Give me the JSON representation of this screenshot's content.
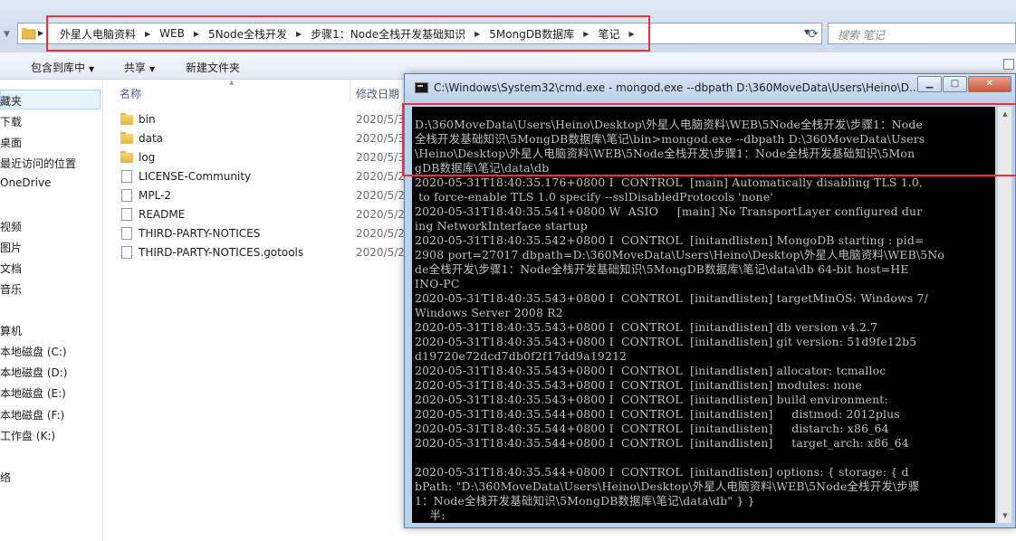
{
  "explorer": {
    "breadcrumbs": [
      "外星人电脑资料",
      "WEB",
      "5Node全栈开发",
      "步骤1：Node全栈开发基础知识",
      "5MongDB数据库",
      "笔记"
    ],
    "search_placeholder": "搜索 笔记",
    "toolbar": {
      "include_library": "包含到库中",
      "share": "共享",
      "new_folder": "新建文件夹"
    },
    "nav": {
      "items": [
        "藏夹",
        "下载",
        "桌面",
        "最近访问的位置",
        "OneDrive",
        "",
        "视频",
        "图片",
        "文档",
        "音乐",
        "",
        "算机",
        "本地磁盘 (C:)",
        "本地磁盘 (D:)",
        "本地磁盘 (E:)",
        "本地磁盘 (F:)",
        "工作盘 (K:)",
        "",
        "络"
      ]
    },
    "columns": {
      "name": "名称",
      "modified": "修改日期"
    },
    "files": [
      {
        "name": "bin",
        "type": "folder",
        "date": "2020/5/3"
      },
      {
        "name": "data",
        "type": "folder",
        "date": "2020/5/3"
      },
      {
        "name": "log",
        "type": "folder",
        "date": "2020/5/3"
      },
      {
        "name": "LICENSE-Community",
        "type": "file",
        "date": "2020/5/2"
      },
      {
        "name": "MPL-2",
        "type": "file",
        "date": "2020/5/2"
      },
      {
        "name": "README",
        "type": "file",
        "date": "2020/5/2"
      },
      {
        "name": "THIRD-PARTY-NOTICES",
        "type": "file",
        "date": "2020/5/2"
      },
      {
        "name": "THIRD-PARTY-NOTICES.gotools",
        "type": "file",
        "date": "2020/5/2"
      }
    ]
  },
  "cmd": {
    "title": "C:\\Windows\\System32\\cmd.exe - mongod.exe  --dbpath D:\\360MoveData\\Users\\Heino\\D...",
    "lines": [
      "D:\\360MoveData\\Users\\Heino\\Desktop\\外星人电脑资料\\WEB\\5Node全栈开发\\步骤1：Node",
      "全栈开发基础知识\\5MongDB数据库\\笔记\\bin>mongod.exe --dbpath D:\\360MoveData\\Users",
      "\\Heino\\Desktop\\外星人电脑资料\\WEB\\5Node全栈开发\\步骤1：Node全栈开发基础知识\\5Mon",
      "gDB数据库\\笔记\\data\\db",
      "2020-05-31T18:40:35.176+0800 I  CONTROL  [main] Automatically disabling TLS 1.0,",
      " to force-enable TLS 1.0 specify --sslDisabledProtocols 'none'",
      "2020-05-31T18:40:35.541+0800 W  ASIO     [main] No TransportLayer configured dur",
      "ing NetworkInterface startup",
      "2020-05-31T18:40:35.542+0800 I  CONTROL  [initandlisten] MongoDB starting : pid=",
      "2908 port=27017 dbpath=D:\\360MoveData\\Users\\Heino\\Desktop\\外星人电脑资料\\WEB\\5No",
      "de全栈开发\\步骤1：Node全栈开发基础知识\\5MongDB数据库\\笔记\\data\\db 64-bit host=HE",
      "INO-PC",
      "2020-05-31T18:40:35.543+0800 I  CONTROL  [initandlisten] targetMinOS: Windows 7/",
      "Windows Server 2008 R2",
      "2020-05-31T18:40:35.543+0800 I  CONTROL  [initandlisten] db version v4.2.7",
      "2020-05-31T18:40:35.543+0800 I  CONTROL  [initandlisten] git version: 51d9fe12b5",
      "d19720e72dcd7db0f2f17dd9a19212",
      "2020-05-31T18:40:35.543+0800 I  CONTROL  [initandlisten] allocator: tcmalloc",
      "2020-05-31T18:40:35.543+0800 I  CONTROL  [initandlisten] modules: none",
      "2020-05-31T18:40:35.543+0800 I  CONTROL  [initandlisten] build environment:",
      "2020-05-31T18:40:35.544+0800 I  CONTROL  [initandlisten]     distmod: 2012plus",
      "2020-05-31T18:40:35.544+0800 I  CONTROL  [initandlisten]     distarch: x86_64",
      "2020-05-31T18:40:35.544+0800 I  CONTROL  [initandlisten]     target_arch: x86_64",
      "",
      "2020-05-31T18:40:35.544+0800 I  CONTROL  [initandlisten] options: { storage: { d",
      "bPath: \"D:\\360MoveData\\Users\\Heino\\Desktop\\外星人电脑资料\\WEB\\5Node全栈开发\\步骤",
      "1：Node全栈开发基础知识\\5MongDB数据库\\笔记\\data\\db\" } }",
      "    半:"
    ]
  },
  "colors": {
    "highlight": "#e8333a",
    "cmd_bg": "#000000",
    "cmd_fg": "#c0c0c0",
    "explorer_chrome": "#dfe9f5"
  }
}
